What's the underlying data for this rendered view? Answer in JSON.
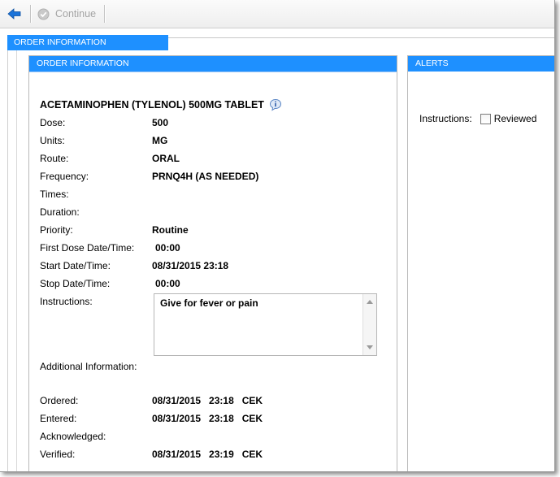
{
  "toolbar": {
    "continue_label": "Continue"
  },
  "tabs": {
    "order_information": "ORDER INFORMATION"
  },
  "order_panel": {
    "header": "ORDER INFORMATION",
    "drug_name": "ACETAMINOPHEN (TYLENOL) 500MG TABLET",
    "fields": {
      "dose": {
        "label": "Dose:",
        "value": "500"
      },
      "units": {
        "label": "Units:",
        "value": "MG"
      },
      "route": {
        "label": "Route:",
        "value": "ORAL"
      },
      "frequency": {
        "label": "Frequency:",
        "value": "PRNQ4H (AS NEEDED)"
      },
      "times": {
        "label": "Times:",
        "value": ""
      },
      "duration": {
        "label": "Duration:",
        "value": ""
      },
      "priority": {
        "label": "Priority:",
        "value": "Routine"
      },
      "first_dose": {
        "label": "First Dose Date/Time:",
        "value": "00:00"
      },
      "start": {
        "label": "Start Date/Time:",
        "value": "08/31/2015 23:18"
      },
      "stop": {
        "label": "Stop Date/Time:",
        "value": "00:00"
      },
      "instructions": {
        "label": "Instructions:",
        "value": "Give for fever or pain"
      },
      "additional": {
        "label": "Additional Information:",
        "value": ""
      },
      "ordered": {
        "label": "Ordered:",
        "value": "08/31/2015   23:18   CEK"
      },
      "entered": {
        "label": "Entered:",
        "value": "08/31/2015   23:18   CEK"
      },
      "acknowledged": {
        "label": "Acknowledged:",
        "value": ""
      },
      "verified": {
        "label": "Verified:",
        "value": "08/31/2015   23:19   CEK"
      }
    }
  },
  "alerts_panel": {
    "header": "ALERTS",
    "instructions_label": "Instructions:",
    "reviewed_label": "Reviewed",
    "reviewed_checked": false
  },
  "colors": {
    "header_blue": "#1e90ff",
    "back_arrow": "#1a73d9",
    "disabled_text": "#a4a4a4"
  },
  "icons": {
    "back": "back-arrow-icon",
    "continue": "checkmark-circle-icon",
    "info": "info-icon"
  }
}
